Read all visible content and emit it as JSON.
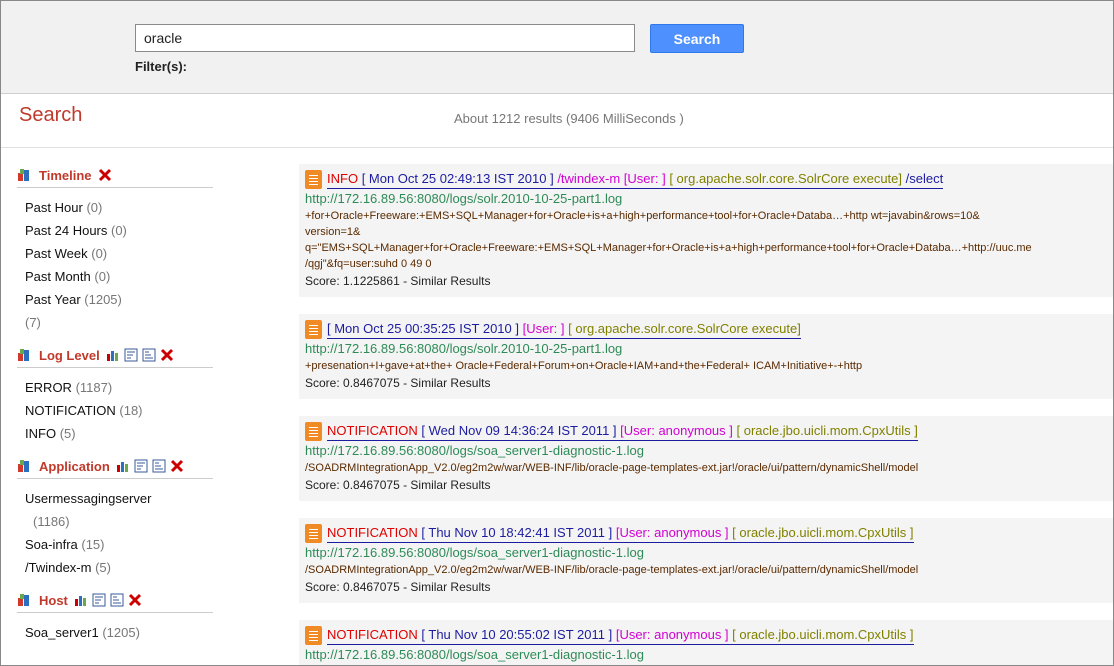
{
  "search": {
    "query": "oracle",
    "button_label": "Search",
    "filters_label": "Filter(s):"
  },
  "page": {
    "title": "Search",
    "stats": "About 1212 results (9406 MilliSeconds )"
  },
  "facets": [
    {
      "title": "Timeline",
      "icons": [
        "facet-icon",
        "remove-icon"
      ],
      "items": [
        {
          "label": "Past Hour",
          "count": "(0)"
        },
        {
          "label": "Past 24 Hours",
          "count": "(0)"
        },
        {
          "label": "Past Week",
          "count": "(0)"
        },
        {
          "label": "Past Month",
          "count": "(0)"
        },
        {
          "label": "Past Year",
          "count": "(1205)"
        },
        {
          "label": "",
          "count": "(7)"
        }
      ]
    },
    {
      "title": "Log Level",
      "icons": [
        "facet-icon",
        "chart-icon",
        "sort-icon",
        "sort-desc-icon",
        "remove-icon"
      ],
      "items": [
        {
          "label": "ERROR",
          "count": "(1187)"
        },
        {
          "label": "NOTIFICATION",
          "count": "(18)"
        },
        {
          "label": "INFO",
          "count": "(5)"
        }
      ]
    },
    {
      "title": "Application",
      "icons": [
        "facet-icon",
        "chart-icon",
        "sort-icon",
        "sort-desc-icon",
        "remove-icon"
      ],
      "items": [
        {
          "label": "Usermessagingserver",
          "count": "(1186)"
        },
        {
          "label": "Soa-infra",
          "count": "(15)"
        },
        {
          "label": "/Twindex-m",
          "count": "(5)"
        }
      ]
    },
    {
      "title": "Host",
      "icons": [
        "facet-icon",
        "chart-icon",
        "sort-icon",
        "sort-desc-icon",
        "remove-icon"
      ],
      "items": [
        {
          "label": "Soa_server1",
          "count": "(1205)"
        }
      ]
    }
  ],
  "results": [
    {
      "level": "INFO",
      "timestamp": "[ Mon Oct 25 02:49:13 IST 2010 ]",
      "extra": "/twindex-m",
      "user": "[User: ]",
      "class": "[ org.apache.solr.core.SolrCore execute]",
      "tail": "/select",
      "url": "http://172.16.89.56:8080/logs/solr.2010-10-25-part1.log",
      "snippet": [
        "+for+Oracle+Freeware:+EMS+SQL+Manager+for+Oracle+is+a+high+performance+tool+for+Oracle+Databa…+http wt=javabin&rows=10&",
        "version=1&",
        "q=\"EMS+SQL+Manager+for+Oracle+Freeware:+EMS+SQL+Manager+for+Oracle+is+a+high+performance+tool+for+Oracle+Databa…+http://uuc.me",
        "/qgj\"&fq=user:suhd 0 49 0"
      ],
      "score": "Score: 1.1225861",
      "similar": "Similar Results"
    },
    {
      "level": "",
      "timestamp": "[ Mon Oct 25 00:35:25 IST 2010 ]",
      "extra": "",
      "user": "[User: ]",
      "class": "[ org.apache.solr.core.SolrCore execute]",
      "tail": "",
      "url": "http://172.16.89.56:8080/logs/solr.2010-10-25-part1.log",
      "snippet": [
        "+presenation+I+gave+at+the+ Oracle+Federal+Forum+on+Oracle+IAM+and+the+Federal+ ICAM+Initiative+-+http"
      ],
      "score": "Score: 0.8467075",
      "similar": "Similar Results"
    },
    {
      "level": "NOTIFICATION",
      "timestamp": "[ Wed Nov 09 14:36:24 IST 2011 ]",
      "extra": "",
      "user": "[User: anonymous ]",
      "class": "[ oracle.jbo.uicli.mom.CpxUtils ]",
      "tail": "",
      "url": "http://172.16.89.56:8080/logs/soa_server1-diagnostic-1.log",
      "snippet": [
        "/SOADRMIntegrationApp_V2.0/eg2m2w/war/WEB-INF/lib/oracle-page-templates-ext.jar!/oracle/ui/pattern/dynamicShell/model"
      ],
      "score": "Score: 0.8467075",
      "similar": "Similar Results"
    },
    {
      "level": "NOTIFICATION",
      "timestamp": "[ Thu Nov 10 18:42:41 IST 2011 ]",
      "extra": "",
      "user": "[User: anonymous ]",
      "class": "[ oracle.jbo.uicli.mom.CpxUtils ]",
      "tail": "",
      "url": "http://172.16.89.56:8080/logs/soa_server1-diagnostic-1.log",
      "snippet": [
        "/SOADRMIntegrationApp_V2.0/eg2m2w/war/WEB-INF/lib/oracle-page-templates-ext.jar!/oracle/ui/pattern/dynamicShell/model"
      ],
      "score": "Score: 0.8467075",
      "similar": "Similar Results"
    },
    {
      "level": "NOTIFICATION",
      "timestamp": "[ Thu Nov 10 20:55:02 IST 2011 ]",
      "extra": "",
      "user": "[User: anonymous ]",
      "class": "[ oracle.jbo.uicli.mom.CpxUtils ]",
      "tail": "",
      "url": "http://172.16.89.56:8080/logs/soa_server1-diagnostic-1.log",
      "snippet": [],
      "score": "",
      "similar": ""
    }
  ]
}
